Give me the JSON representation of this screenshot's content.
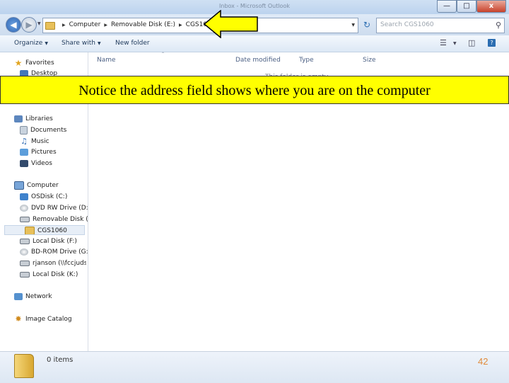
{
  "window": {
    "title": "Inbox - Microsoft Outlook",
    "controls": {
      "minimize": "—",
      "maximize": "□",
      "close": "x"
    }
  },
  "address_bar": {
    "breadcrumbs": [
      "Computer",
      "Removable Disk (E:)",
      "CGS1060"
    ],
    "search_placeholder": "Search CGS1060"
  },
  "toolbar": {
    "organize": "Organize",
    "share_with": "Share with",
    "new_folder": "New folder"
  },
  "nav": {
    "favorites": "Favorites",
    "desktop": "Desktop",
    "libraries": "Libraries",
    "documents": "Documents",
    "music": "Music",
    "pictures": "Pictures",
    "videos": "Videos",
    "computer": "Computer",
    "osdisk": "OSDisk (C:)",
    "dvd": "DVD RW Drive (D:) S",
    "removable": "Removable Disk (E:)",
    "cgs1060": "CGS1060",
    "local_f": "Local Disk (F:)",
    "bdrom": "BD-ROM Drive (G:) (",
    "rjanson": "rjanson (\\\\fccjudsv",
    "local_k": "Local Disk (K:)",
    "network": "Network",
    "image_catalog": "Image Catalog"
  },
  "columns": {
    "name": "Name",
    "date_modified": "Date modified",
    "type": "Type",
    "size": "Size"
  },
  "content": {
    "empty_message": "This folder is empty."
  },
  "status": {
    "item_count": "0 items"
  },
  "annotation": {
    "text": "Notice the address field shows where you are on the computer",
    "arrow_color": "#ffff00",
    "banner_color": "#ffff00"
  },
  "slide_number": "42"
}
